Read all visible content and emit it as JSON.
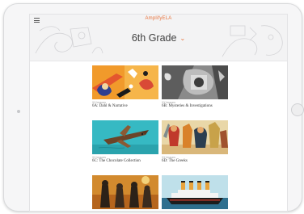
{
  "app": {
    "brand": "AmplifyELA"
  },
  "header": {
    "grade": "6th Grade",
    "chevron_icon": "chevron-down-icon"
  },
  "units": [
    {
      "meta": "XX lessons",
      "title": "6A: Dahl & Narrative"
    },
    {
      "meta": "XX lessons",
      "title": "6B: Mysteries & Investigations"
    },
    {
      "meta": "XX lessons",
      "title": "6C: The Chocolate Collection"
    },
    {
      "meta": "XX lessons",
      "title": "6D: The Greeks"
    },
    {
      "meta": "",
      "title": ""
    },
    {
      "meta": "",
      "title": ""
    }
  ],
  "colors": {
    "accent": "#e8733c",
    "header_bg": "#f3f3f4"
  }
}
